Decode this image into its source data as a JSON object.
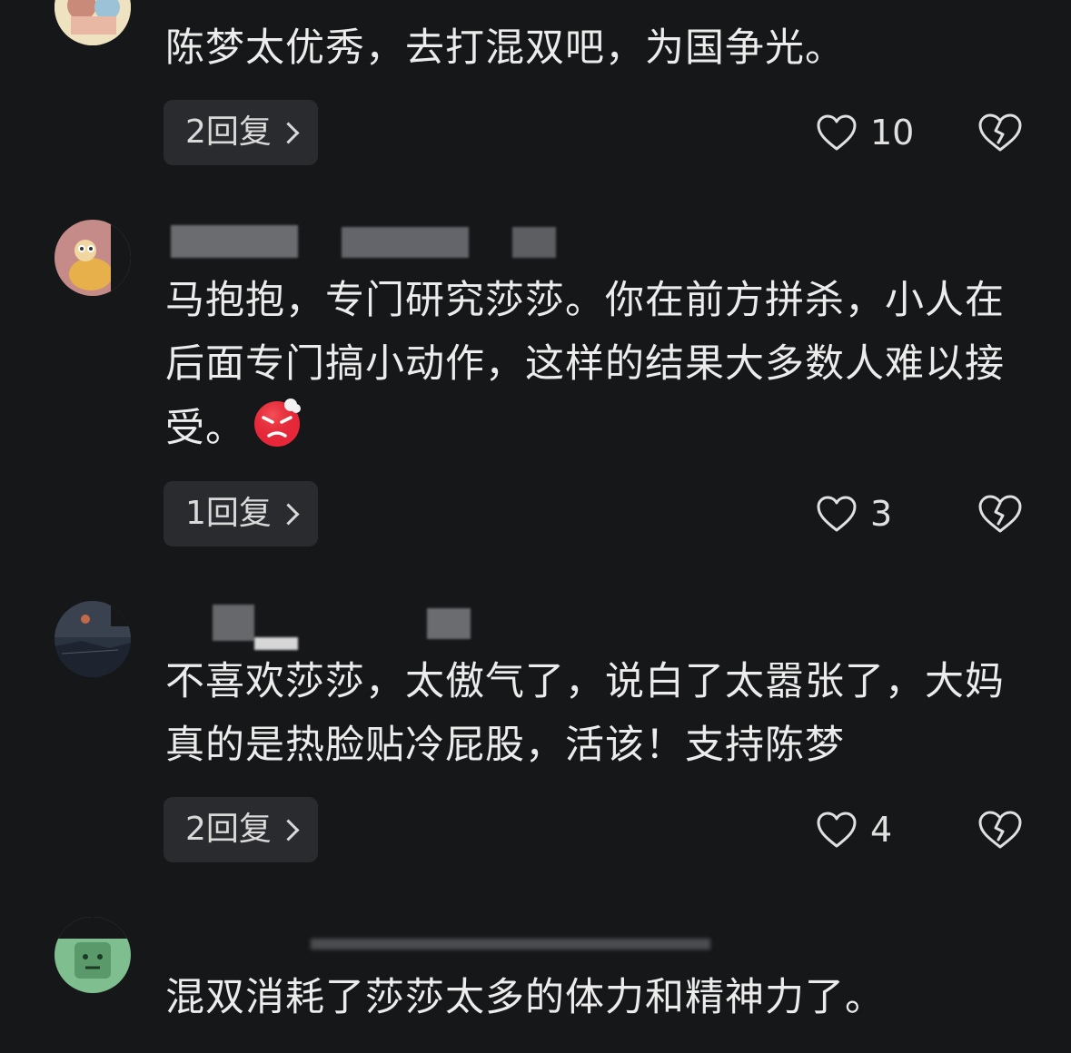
{
  "comments": [
    {
      "text": "陈梦太优秀，去打混双吧，为国争光。",
      "replies": "2回复",
      "likes": "10"
    },
    {
      "text": "马抱抱，专门研究莎莎。你在前方拼杀，小人在后面专门搞小动作，这样的结果大多数人难以接受。",
      "replies": "1回复",
      "likes": "3"
    },
    {
      "text": "不喜欢莎莎，太傲气了，说白了太嚣张了，大妈真的是热脸贴冷屁股，活该！支持陈梦",
      "replies": "2回复",
      "likes": "4"
    },
    {
      "text": "混双消耗了莎莎太多的体力和精神力了。"
    }
  ],
  "icons": {
    "like": "heart-outline-icon",
    "dislike": "broken-heart-icon",
    "reply_chevron": "chevron-right-icon",
    "emoji": "angry-face-emoji"
  },
  "colors": {
    "background": "#161719",
    "text": "#ececec",
    "button_bg": "#2a2b2e"
  }
}
